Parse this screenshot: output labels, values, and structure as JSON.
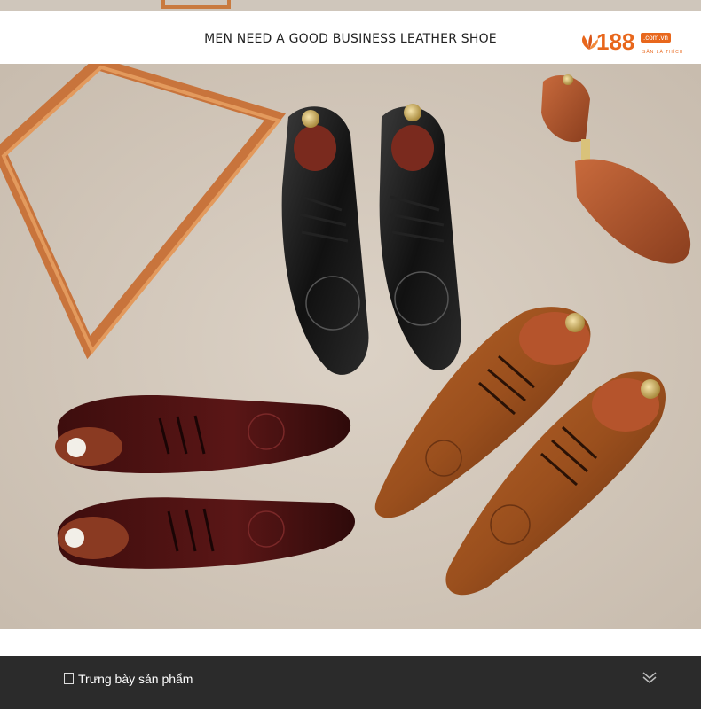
{
  "header": {
    "title": "MEN NEED A GOOD BUSINESS LEATHER SHOE",
    "logo": {
      "number": "188",
      "domain": ".com.vn",
      "tagline": "SĂN LÀ THÍCH"
    }
  },
  "photo": {
    "description_icon": "product-photo"
  },
  "bottom_bar": {
    "label": "Trưng bày sản phẩm",
    "expand_icon": "double-chevron-down-icon"
  },
  "colors": {
    "accent": "#e8671c",
    "bar_bg": "#2b2b2b"
  }
}
